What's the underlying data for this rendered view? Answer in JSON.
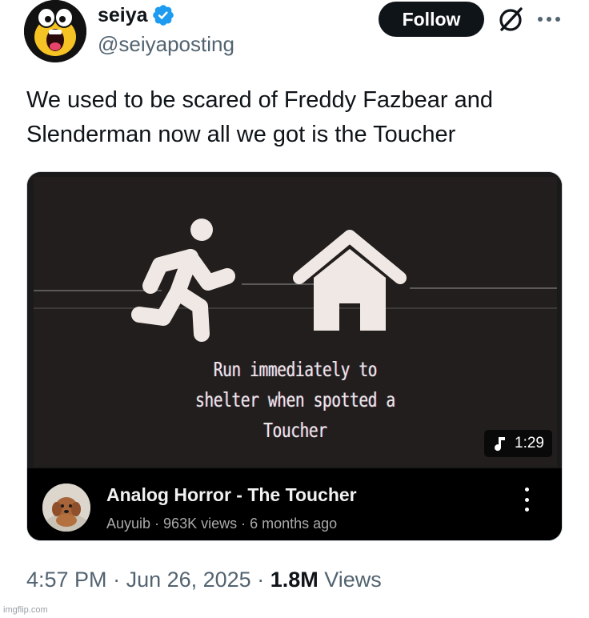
{
  "author": {
    "name": "seiya",
    "handle": "@seiyaposting",
    "verified": true,
    "avatar_icon": "yellow-cartoon-face-icon"
  },
  "actions": {
    "follow_label": "Follow",
    "grok_icon": "grok-icon",
    "more_icon": "more-horizontal-icon"
  },
  "tweet": {
    "line1": "We used to be scared of Freddy Fazbear and",
    "line2": "Slenderman now all we got is the Toucher"
  },
  "video": {
    "caption_line1": "Run immediately to",
    "caption_line2": "shelter when spotted a",
    "caption_line3": "Toucher",
    "duration": "1:29",
    "title": "Analog Horror - The Toucher",
    "channel": "Auyuib",
    "views": "963K views",
    "age": "6 months ago",
    "separator": " · "
  },
  "meta": {
    "time": "4:57 PM",
    "date": "Jun 26, 2025",
    "views_count": "1.8M",
    "views_label": "Views",
    "separator": " · "
  },
  "watermark": "imgflip.com",
  "colors": {
    "accent": "#1d9bf0",
    "text": "#0f1419",
    "secondary": "#536471"
  }
}
